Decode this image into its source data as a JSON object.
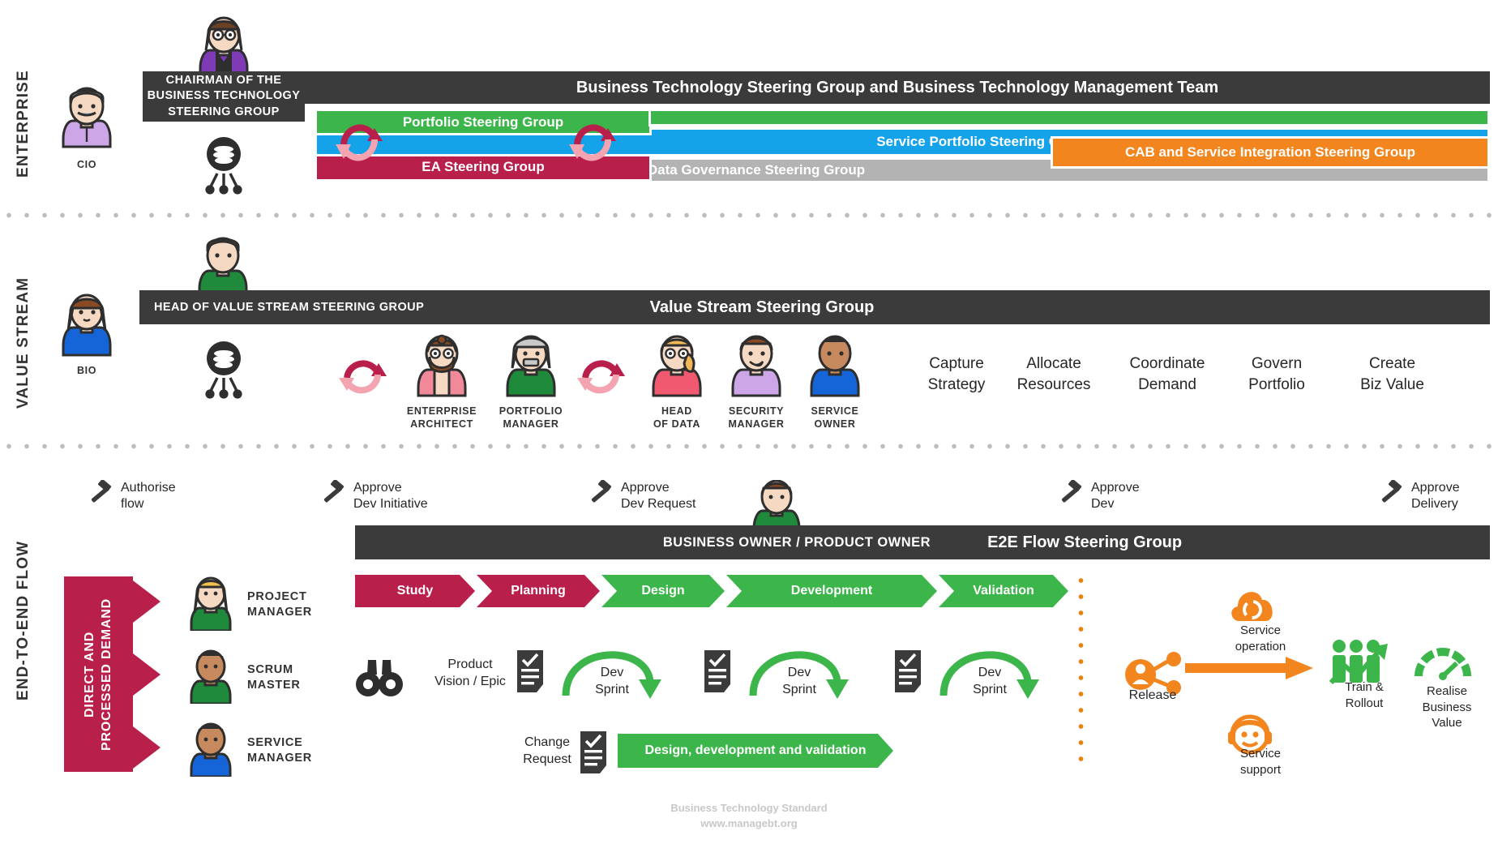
{
  "lanes": [
    {
      "id": "enterprise",
      "label": "ENTERPRISE"
    },
    {
      "id": "value-stream",
      "label": "VALUE STREAM"
    },
    {
      "id": "e2e",
      "label": "END-TO-END FLOW"
    }
  ],
  "enterprise": {
    "cio_caption": "CIO",
    "chairman_label": "CHAIRMAN OF THE\nBUSINESS TECHNOLOGY\nSTEERING GROUP",
    "chairman_label_lines": [
      "CHAIRMAN OF THE",
      "BUSINESS TECHNOLOGY",
      "STEERING GROUP"
    ],
    "header_bar": "Business Technology Steering Group and Business Technology Management Team",
    "bars": [
      {
        "label": "Portfolio Steering Group",
        "color": "#3cb54a"
      },
      {
        "label": "Service Portfolio Steering Group",
        "color": "#14a2e8"
      },
      {
        "label": "EA Steering Group",
        "color": "#b91f4b"
      },
      {
        "label": "Data Governance Steering Group",
        "color": "#b3b3b3"
      },
      {
        "label": "CAB and Service Integration Steering Group",
        "color": "#f2851e"
      }
    ]
  },
  "value_stream": {
    "bio_caption": "BIO",
    "head_bar_left": "HEAD OF VALUE STREAM STEERING GROUP",
    "head_bar_title": "Value Stream Steering Group",
    "roles": [
      {
        "label_lines": [
          "ENTERPRISE",
          "ARCHITECT"
        ]
      },
      {
        "label_lines": [
          "PORTFOLIO",
          "MANAGER"
        ]
      },
      {
        "label_lines": [
          "HEAD",
          "OF DATA"
        ]
      },
      {
        "label_lines": [
          "SECURITY",
          "MANAGER"
        ]
      },
      {
        "label_lines": [
          "SERVICE",
          "OWNER"
        ]
      }
    ],
    "activities": [
      {
        "lines": [
          "Capture",
          "Strategy"
        ]
      },
      {
        "lines": [
          "Allocate",
          "Resources"
        ]
      },
      {
        "lines": [
          "Coordinate",
          "Demand"
        ]
      },
      {
        "lines": [
          "Govern",
          "Portfolio"
        ]
      },
      {
        "lines": [
          "Create",
          "Biz Value"
        ]
      }
    ]
  },
  "e2e": {
    "approvals": [
      {
        "lines": [
          "Authorise",
          "flow"
        ]
      },
      {
        "lines": [
          "Approve",
          "Dev Initiative"
        ]
      },
      {
        "lines": [
          "Approve",
          "Dev Request"
        ]
      },
      {
        "lines": [
          "Approve",
          "Dev"
        ]
      },
      {
        "lines": [
          "Approve",
          "Delivery"
        ]
      }
    ],
    "owner_bar_label": "BUSINESS OWNER / PRODUCT OWNER",
    "owner_bar_title": "E2E Flow Steering Group",
    "demand_label_lines": [
      "DIRECT AND",
      "PROCESSED DEMAND"
    ],
    "roles": [
      {
        "lines": [
          "PROJECT",
          "MANAGER"
        ]
      },
      {
        "lines": [
          "SCRUM",
          "MASTER"
        ]
      },
      {
        "lines": [
          "SERVICE",
          "MANAGER"
        ]
      }
    ],
    "stages": [
      {
        "label": "Study",
        "color": "#b91f4b"
      },
      {
        "label": "Planning",
        "color": "#b91f4b"
      },
      {
        "label": "Design",
        "color": "#3cb54a"
      },
      {
        "label": "Development",
        "color": "#3cb54a"
      },
      {
        "label": "Validation",
        "color": "#3cb54a"
      }
    ],
    "product_vision_lines": [
      "Product",
      "Vision / Epic"
    ],
    "sprints": [
      {
        "lines": [
          "Dev",
          "Sprint"
        ]
      },
      {
        "lines": [
          "Dev",
          "Sprint"
        ]
      },
      {
        "lines": [
          "Dev",
          "Sprint"
        ]
      }
    ],
    "change_request_lines": [
      "Change",
      "Request"
    ],
    "change_stage": {
      "label": "Design, development and validation",
      "color": "#3cb54a"
    },
    "release_label": "Release",
    "service_operation_lines": [
      "Service",
      "operation"
    ],
    "service_support_lines": [
      "Service",
      "support"
    ],
    "train_rollout_lines": [
      "Train &",
      "Rollout"
    ],
    "realise_value_lines": [
      "Realise",
      "Business",
      "Value"
    ]
  },
  "footer": {
    "line1": "Business Technology Standard",
    "line2": "www.managebt.org"
  },
  "colors": {
    "dark": "#3b3b3b",
    "green": "#3cb54a",
    "blue": "#14a2e8",
    "crimson": "#b91f4b",
    "grey": "#b3b3b3",
    "orange": "#f2851e",
    "pink": "#f4a3b0"
  }
}
